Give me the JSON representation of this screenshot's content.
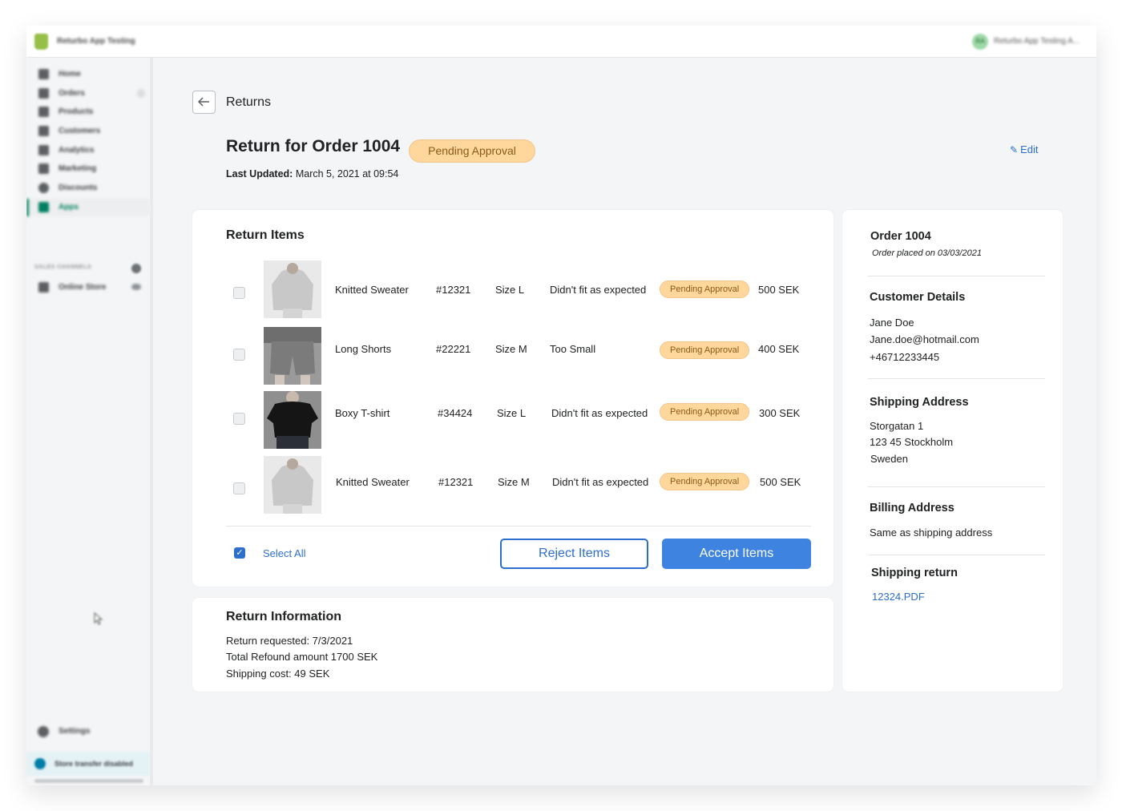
{
  "app": {
    "store_name": "Returbo App Testing",
    "account_initials": "RA",
    "account_name": "Returbo App Testing A..."
  },
  "sidebar": {
    "items": [
      {
        "label": "Home",
        "icon": "home-icon"
      },
      {
        "label": "Orders",
        "icon": "orders-icon"
      },
      {
        "label": "Products",
        "icon": "tag-icon"
      },
      {
        "label": "Customers",
        "icon": "person-icon"
      },
      {
        "label": "Analytics",
        "icon": "bar-chart-icon"
      },
      {
        "label": "Marketing",
        "icon": "megaphone-icon"
      },
      {
        "label": "Discounts",
        "icon": "discount-icon"
      },
      {
        "label": "Apps",
        "icon": "apps-icon",
        "active": true
      }
    ],
    "channels_heading": "SALES CHANNELS",
    "online_store": "Online Store",
    "settings": "Settings",
    "transfer_notice": "Store transfer disabled"
  },
  "header": {
    "breadcrumb": "Returns",
    "title": "Return for Order 1004",
    "status": "Pending Approval",
    "edit": "Edit",
    "last_updated_label": "Last Updated:",
    "last_updated_value": "March 5, 2021 at 09:54"
  },
  "return_items": {
    "title": "Return Items",
    "rows": [
      {
        "name": "Knitted Sweater",
        "sku": "#12321",
        "size": "Size L",
        "reason": "Didn't fit as expected",
        "status": "Pending Approval",
        "price": "500 SEK",
        "image": "light-sweater"
      },
      {
        "name": "Long Shorts",
        "sku": "#22221",
        "size": "Size M",
        "reason": "Too Small",
        "status": "Pending Approval",
        "price": "400 SEK",
        "image": "shorts"
      },
      {
        "name": "Boxy T-shirt",
        "sku": "#34424",
        "size": "Size L",
        "reason": "Didn't fit as expected",
        "status": "Pending Approval",
        "price": "300 SEK",
        "image": "black-tshirt"
      },
      {
        "name": "Knitted Sweater",
        "sku": "#12321",
        "size": "Size M",
        "reason": "Didn't fit as expected",
        "status": "Pending Approval",
        "price": "500 SEK",
        "image": "light-sweater"
      }
    ],
    "select_all": "Select All",
    "reject": "Reject Items",
    "accept": "Accept Items"
  },
  "return_info": {
    "title": "Return Information",
    "requested": "Return requested:  7/3/2021",
    "total": "Total Refound amount 1700 SEK",
    "shipping": "Shipping cost: 49 SEK"
  },
  "order_panel": {
    "title": "Order 1004",
    "placed": "Order placed on 03/03/2021",
    "customer_heading": "Customer Details",
    "customer_name": "Jane Doe",
    "customer_email": "Jane.doe@hotmail.com",
    "customer_phone": "+46712233445",
    "shipping_heading": "Shipping Address",
    "ship_line1": "Storgatan 1",
    "ship_line2": "123 45 Stockholm",
    "ship_line3": "Sweden",
    "billing_heading": "Billing Address",
    "billing_value": "Same as shipping address",
    "return_heading": "Shipping return",
    "return_file": "12324.PDF"
  },
  "colors": {
    "accent": "#2c6ecb",
    "accept_button": "#3f83e0",
    "pending_pill": "#ffd79d",
    "pending_text": "#8a5a14",
    "shopify_green": "#008060"
  }
}
